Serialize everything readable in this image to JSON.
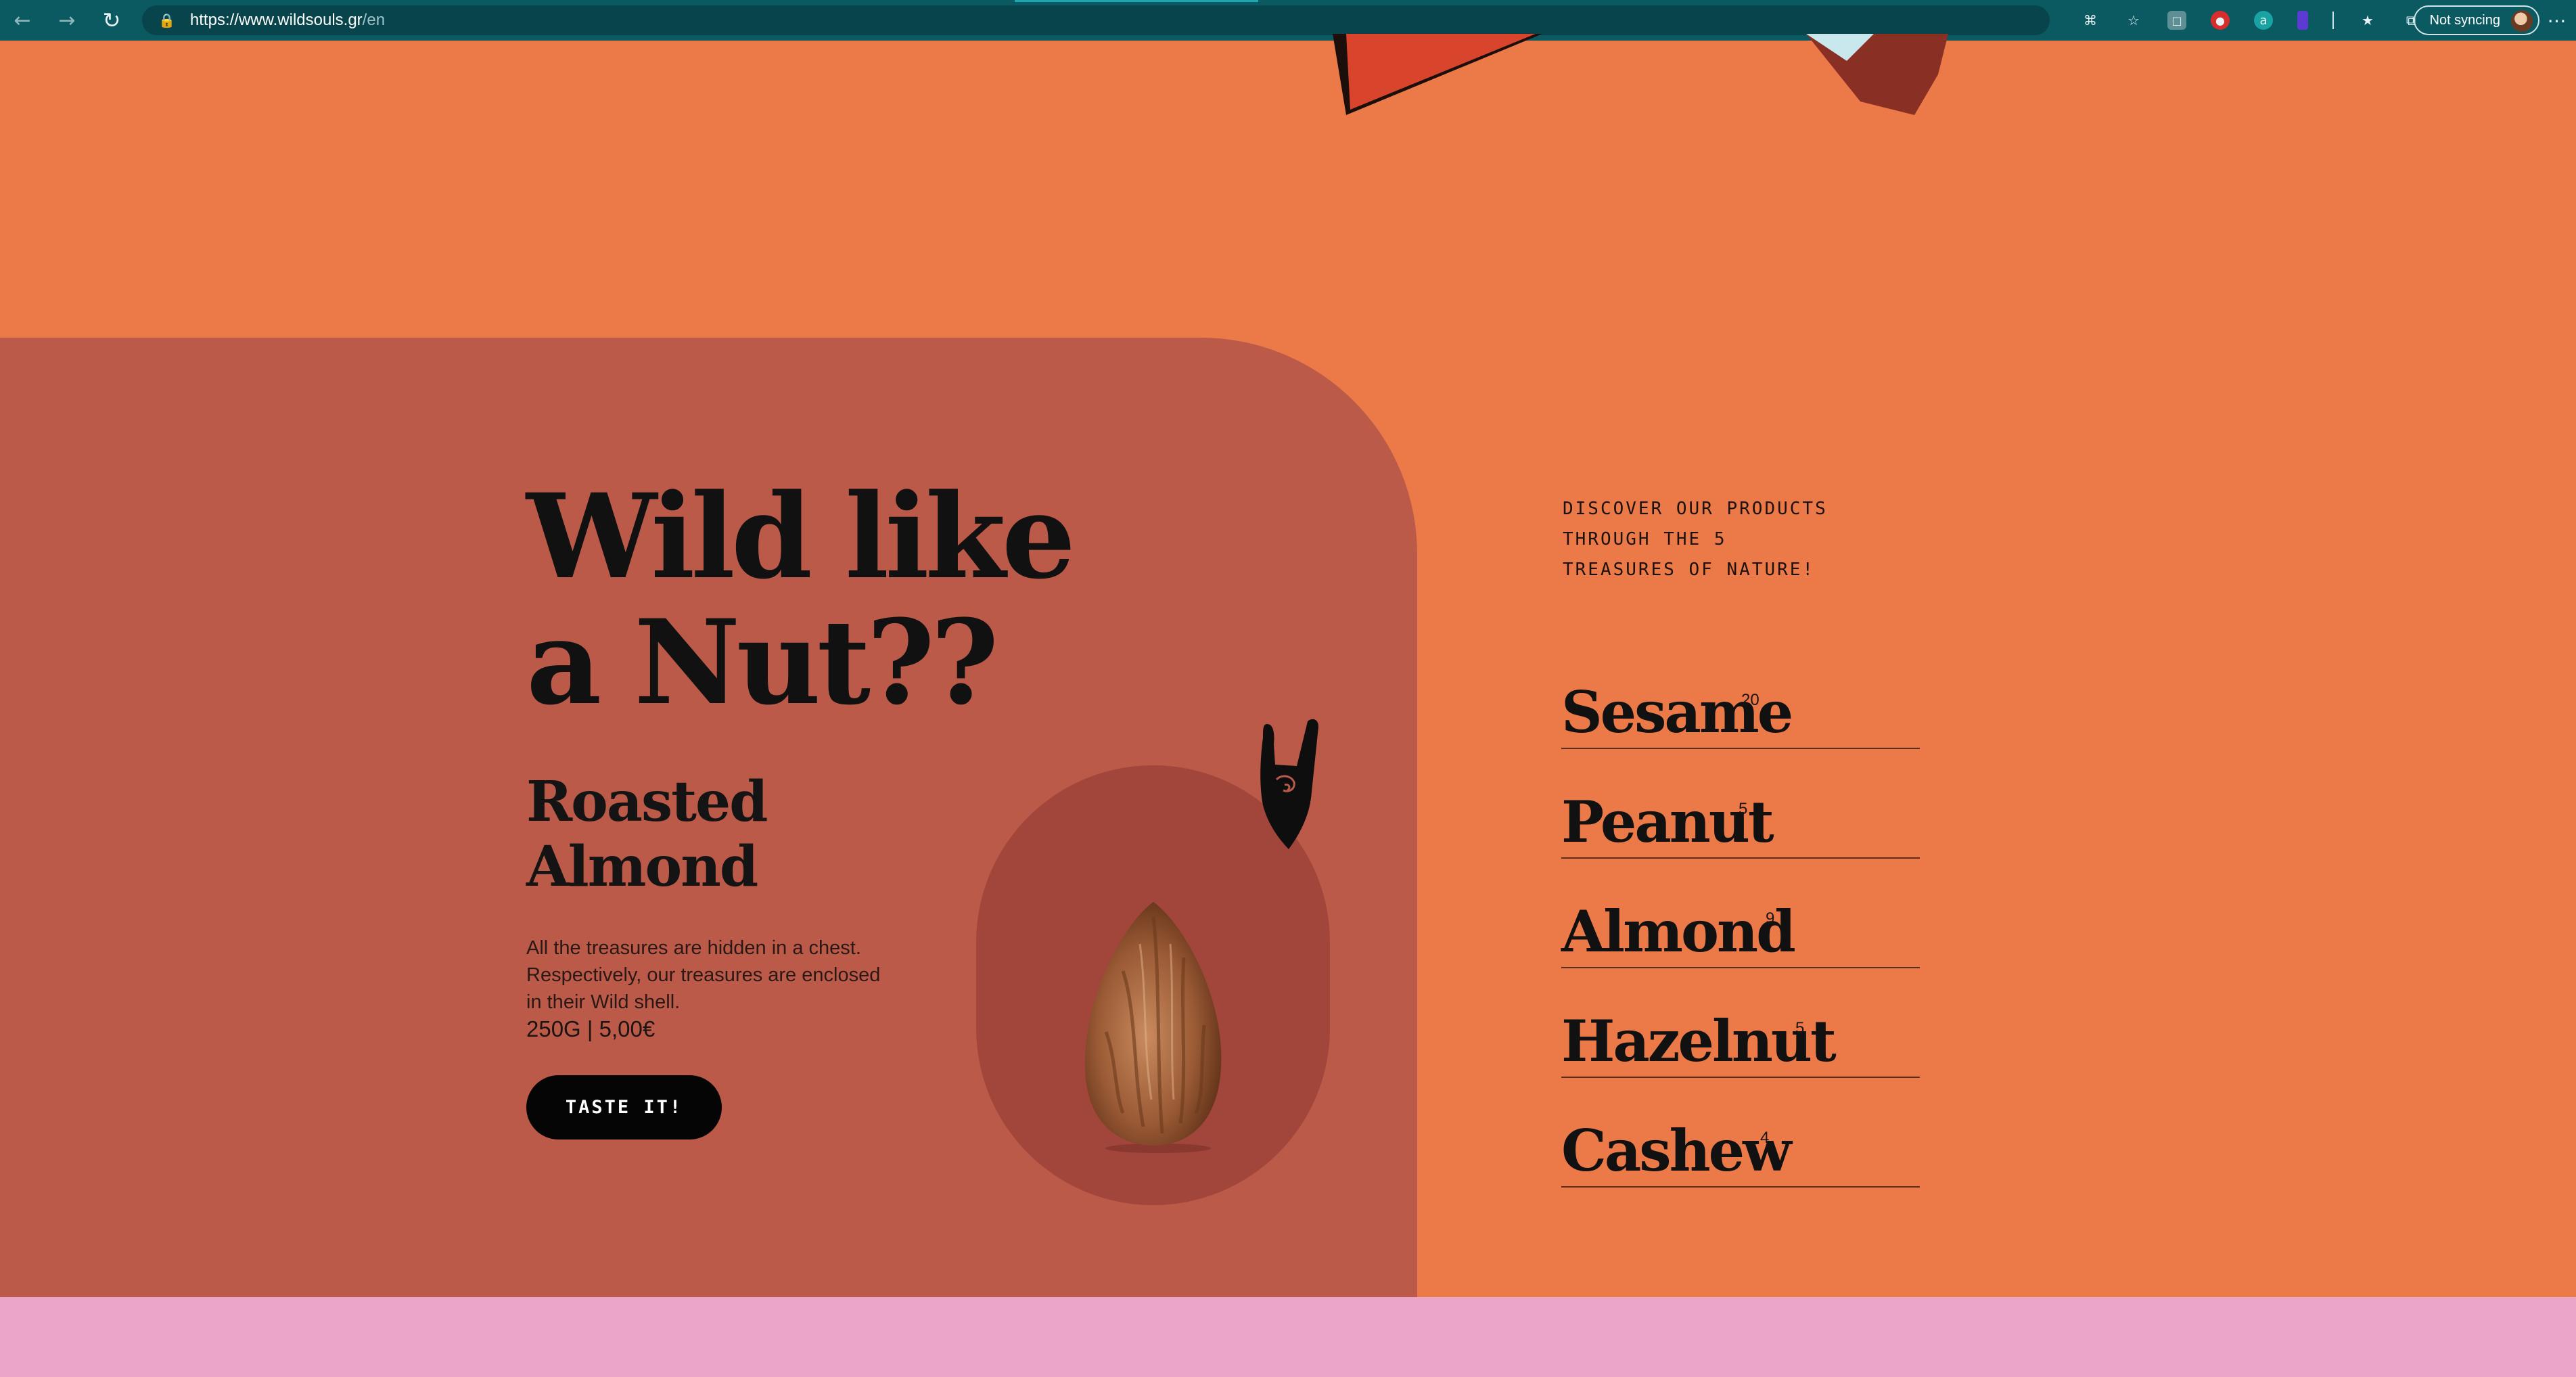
{
  "browser": {
    "url_host": "https://www.wildsouls.gr",
    "url_path": "/en",
    "sync_label": "Not syncing",
    "icons": [
      "back-arrow-icon",
      "forward-arrow-icon",
      "reload-icon",
      "lock-icon",
      "apps-icon",
      "favorite-add-icon",
      "extension-icons",
      "favorites-icon",
      "collections-icon",
      "more-icon"
    ]
  },
  "hero": {
    "title": "Wild like a Nut??",
    "product_name": "Roasted Almond",
    "description": "All the treasures are hidden in a chest. Respectively, our treasures are enclosed in their Wild shell.",
    "price": "250G | 5,00€",
    "cta_label": "TASTE IT!"
  },
  "discover": {
    "intro": "DISCOVER OUR PRODUCTS THROUGH THE 5 TREASURES OF NATURE!",
    "items": [
      {
        "name": "Sesame",
        "count": "20"
      },
      {
        "name": "Peanut",
        "count": "5"
      },
      {
        "name": "Almond",
        "count": "9"
      },
      {
        "name": "Hazelnut",
        "count": "5"
      },
      {
        "name": "Cashew",
        "count": "4"
      }
    ]
  },
  "colors": {
    "page_background": "#ec7a48",
    "hero_panel": "#bc5a49",
    "nut_oval": "#a2453b",
    "next_section": "#e9a6c8",
    "browser_bar": "#0b5a62"
  }
}
